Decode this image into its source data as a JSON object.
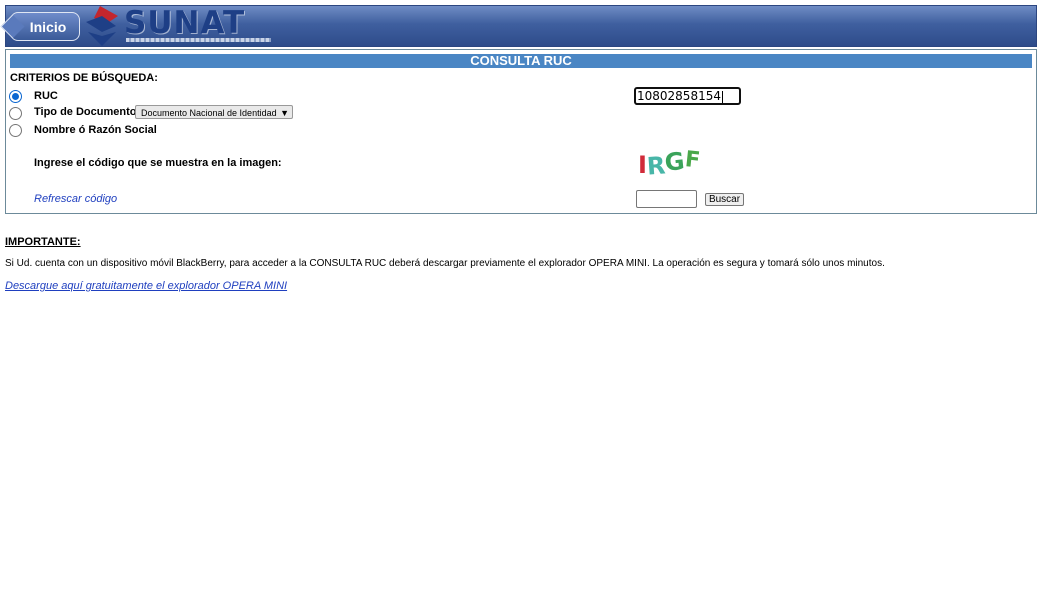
{
  "header": {
    "back_label": "Inicio",
    "logo_text": "SUNAT",
    "logo_icon": "sunat-s-logo-icon",
    "brand_colors": {
      "bar": "#3f5f9f",
      "logo_red": "#c3262d",
      "logo_blue": "#1e3f86"
    }
  },
  "consulta": {
    "title": "CONSULTA RUC",
    "title_bg": "#4a86c4",
    "criterios_label": "CRITERIOS DE BÚSQUEDA:",
    "options": [
      {
        "label": "RUC",
        "selected": true
      },
      {
        "label": "Tipo de Documento",
        "selected": false
      },
      {
        "label": "Nombre ó Razón Social",
        "selected": false
      }
    ],
    "tipo_documento_selected": "Documento Nacional de Identidad",
    "ruc_value": "10802858154",
    "captcha_prompt": "Ingrese el código que se muestra en la imagen:",
    "captcha_text": "IRGF",
    "refrescar_label": "Refrescar código",
    "code_value": "",
    "buscar_label": "Buscar"
  },
  "importante": {
    "heading": "IMPORTANTE:",
    "text": "Si Ud. cuenta con un dispositivo móvil BlackBerry, para acceder a la CONSULTA RUC deberá descargar previamente el explorador OPERA MINI. La operación es segura y tomará sólo unos minutos.",
    "link_label": "Descargue aquí gratuitamente el explorador OPERA MINI"
  }
}
